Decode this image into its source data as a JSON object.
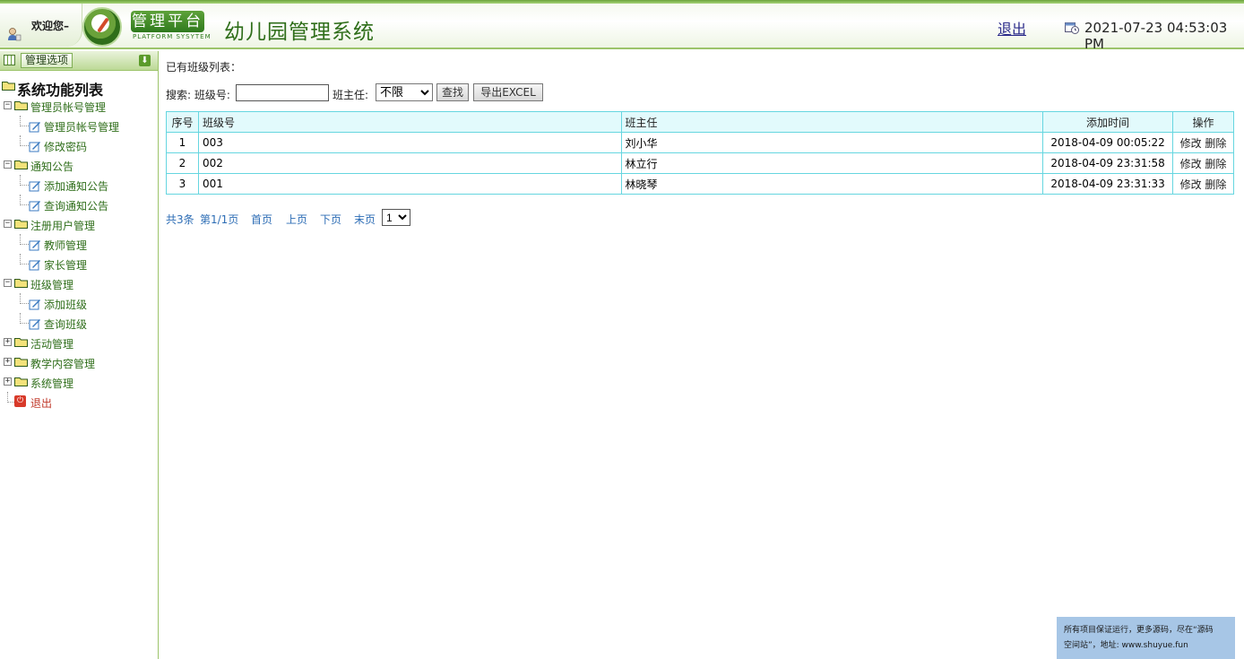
{
  "header": {
    "welcome": "欢迎您–",
    "badge": "管理平台",
    "badge_sub": "PLATFORM SYSYTEM",
    "title": "幼儿园管理系统",
    "logout": "退出",
    "datetime": "2021-07-23 04:53:03 PM"
  },
  "sidebar": {
    "tab_label": "管理选项",
    "root_label": "系统功能列表",
    "groups": [
      {
        "label": "管理员帐号管理",
        "expanded": true,
        "items": [
          "管理员帐号管理",
          "修改密码"
        ]
      },
      {
        "label": "通知公告",
        "expanded": true,
        "items": [
          "添加通知公告",
          "查询通知公告"
        ]
      },
      {
        "label": "注册用户管理",
        "expanded": true,
        "items": [
          "教师管理",
          "家长管理"
        ]
      },
      {
        "label": "班级管理",
        "expanded": true,
        "items": [
          "添加班级",
          "查询班级"
        ]
      },
      {
        "label": "活动管理",
        "expanded": false,
        "items": []
      },
      {
        "label": "教学内容管理",
        "expanded": false,
        "items": []
      },
      {
        "label": "系统管理",
        "expanded": false,
        "items": []
      }
    ],
    "exit_label": "退出"
  },
  "main": {
    "list_title": "已有班级列表：",
    "search": {
      "label": "搜索: 班级号:",
      "class_no_value": "",
      "teacher_label": "班主任:",
      "teacher_selected": "不限",
      "search_button": "查找",
      "export_button": "导出EXCEL"
    },
    "table": {
      "columns": [
        "序号",
        "班级号",
        "班主任",
        "添加时间",
        "操作"
      ],
      "rows": [
        {
          "index": "1",
          "class_no": "003",
          "teacher": "刘小华",
          "added": "2018-04-09 00:05:22",
          "edit": "修改",
          "delete": "删除"
        },
        {
          "index": "2",
          "class_no": "002",
          "teacher": "林立行",
          "added": "2018-04-09 23:31:58",
          "edit": "修改",
          "delete": "删除"
        },
        {
          "index": "3",
          "class_no": "001",
          "teacher": "林晓琴",
          "added": "2018-04-09 23:31:33",
          "edit": "修改",
          "delete": "删除"
        }
      ]
    },
    "pager": {
      "total": "共3条",
      "page": "第1/1页",
      "first": "首页",
      "prev": "上页",
      "next": "下页",
      "last": "末页",
      "page_select": "1"
    }
  },
  "notice": {
    "line1": "所有项目保证运行，更多源码，尽在“源码",
    "line2": "空间站”，地址: www.shuyue.fun"
  },
  "colors": {
    "brand_green": "#2f6e1a",
    "table_border": "#66d6e0",
    "table_header_bg": "#e2fafc",
    "notice_bg": "#a7c6e6"
  }
}
